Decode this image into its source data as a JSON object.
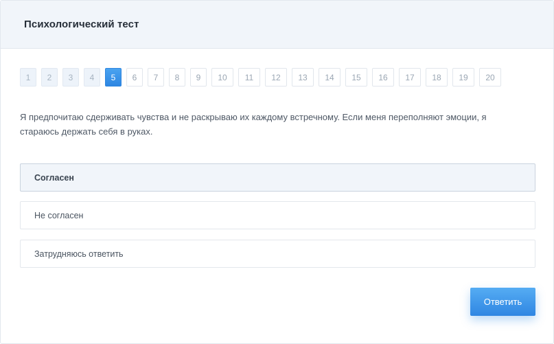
{
  "header": {
    "title": "Психологический тест"
  },
  "pagination": {
    "pages": [
      "1",
      "2",
      "3",
      "4",
      "5",
      "6",
      "7",
      "8",
      "9",
      "10",
      "11",
      "12",
      "13",
      "14",
      "15",
      "16",
      "17",
      "18",
      "19",
      "20"
    ],
    "current": "5"
  },
  "question": {
    "text": "Я предпочитаю сдерживать чувства и не раскрываю их каждому встречному. Если меня переполняют эмоции, я стараюсь держать себя в руках."
  },
  "options": [
    {
      "label": "Согласен",
      "selected": true
    },
    {
      "label": "Не согласен",
      "selected": false
    },
    {
      "label": "Затрудняюсь ответить",
      "selected": false
    }
  ],
  "actions": {
    "submit_label": "Ответить"
  },
  "colors": {
    "accent": "#3a92e8",
    "header_bg": "#f1f5fa",
    "border": "#e2e7ee"
  }
}
